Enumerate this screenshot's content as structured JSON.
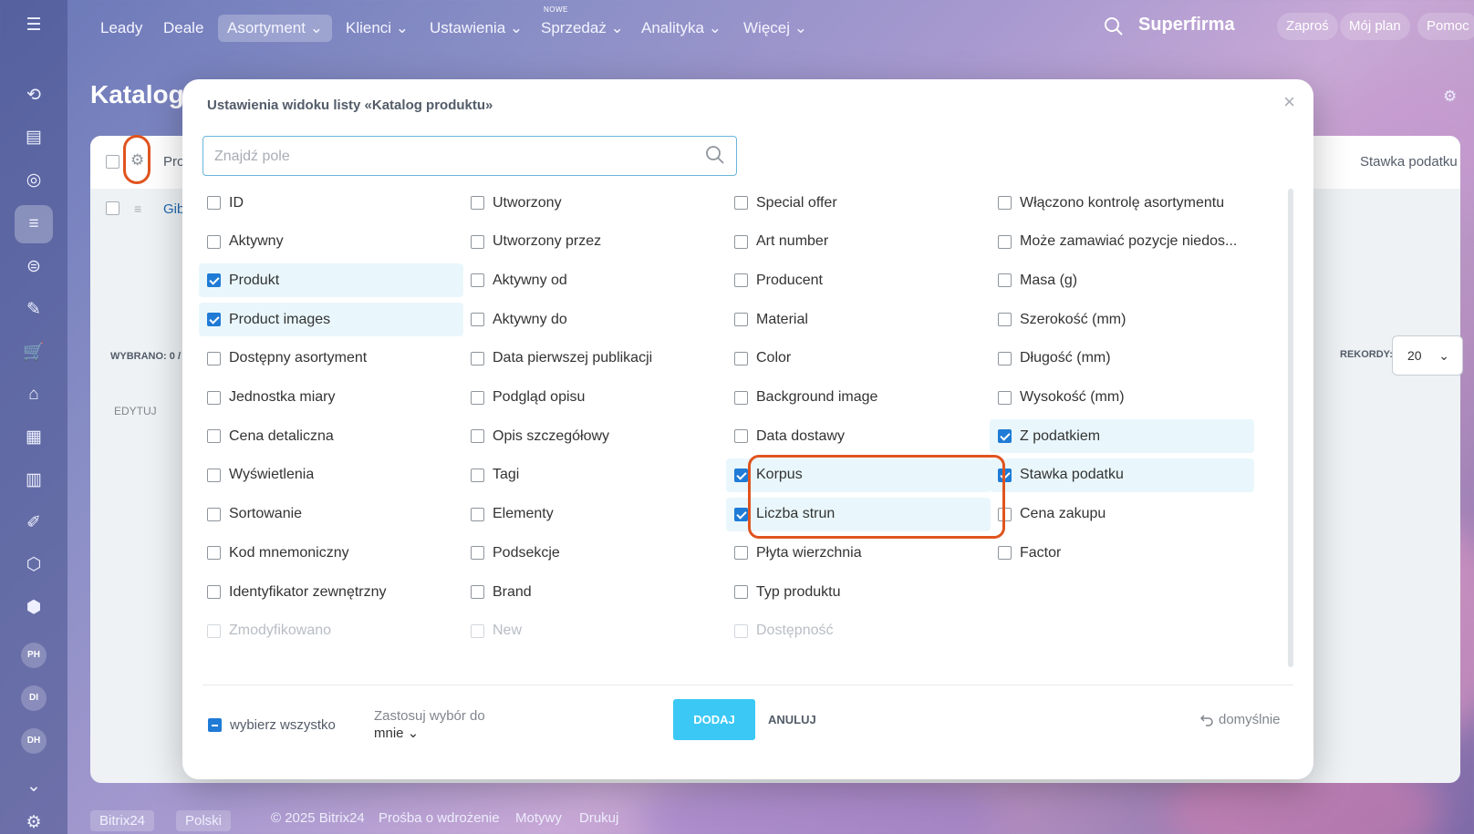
{
  "topnav": {
    "items": [
      {
        "label": "Leady"
      },
      {
        "label": "Deale"
      },
      {
        "label": "Asortyment ⌄"
      },
      {
        "label": "Klienci ⌄"
      },
      {
        "label": "Ustawienia ⌄"
      },
      {
        "label": "Sprzedaż ⌄",
        "badge": "NOWE"
      },
      {
        "label": "Analityka ⌄"
      },
      {
        "label": "Więcej ⌄"
      }
    ],
    "brand": "Superfirma",
    "invite": "Zaproś",
    "my_plan": "Mój plan",
    "help": "Pomoc"
  },
  "sidebar": {
    "avatars": [
      "PH",
      "DI",
      "DH"
    ]
  },
  "background_page": {
    "title": "Katalog",
    "header_product": "Pro",
    "header_tax": "Stawka podatku",
    "row_name": "Gib",
    "selected": "WYBRANO: 0 /",
    "records_label": "REKORDY:",
    "records_value": "20",
    "edit": "EDYTUJ"
  },
  "footer": {
    "brand": "Bitrix24",
    "language": "Polski",
    "copyright": "© 2025 Bitrix24",
    "request": "Prośba o wdrożenie",
    "themes": "Motywy",
    "print": "Drukuj"
  },
  "modal": {
    "title": "Ustawienia widoku listy «Katalog produktu»",
    "search_placeholder": "Znajdź pole",
    "columns": [
      [
        {
          "label": "ID",
          "checked": false
        },
        {
          "label": "Aktywny",
          "checked": false
        },
        {
          "label": "Produkt",
          "checked": true
        },
        {
          "label": "Product images",
          "checked": true
        },
        {
          "label": "Dostępny asortyment",
          "checked": false
        },
        {
          "label": "Jednostka miary",
          "checked": false
        },
        {
          "label": "Cena detaliczna",
          "checked": false
        },
        {
          "label": "Wyświetlenia",
          "checked": false
        },
        {
          "label": "Sortowanie",
          "checked": false
        },
        {
          "label": "Kod mnemoniczny",
          "checked": false
        },
        {
          "label": "Identyfikator zewnętrzny",
          "checked": false
        },
        {
          "label": "Zmodyfikowano",
          "checked": false,
          "disabled": true
        }
      ],
      [
        {
          "label": "Utworzony",
          "checked": false
        },
        {
          "label": "Utworzony przez",
          "checked": false
        },
        {
          "label": "Aktywny od",
          "checked": false
        },
        {
          "label": "Aktywny do",
          "checked": false
        },
        {
          "label": "Data pierwszej publikacji",
          "checked": false
        },
        {
          "label": "Podgląd opisu",
          "checked": false
        },
        {
          "label": "Opis szczegółowy",
          "checked": false
        },
        {
          "label": "Tagi",
          "checked": false
        },
        {
          "label": "Elementy",
          "checked": false
        },
        {
          "label": "Podsekcje",
          "checked": false
        },
        {
          "label": "Brand",
          "checked": false
        },
        {
          "label": "New",
          "checked": false,
          "disabled": true
        }
      ],
      [
        {
          "label": "Special offer",
          "checked": false
        },
        {
          "label": "Art number",
          "checked": false
        },
        {
          "label": "Producent",
          "checked": false
        },
        {
          "label": "Material",
          "checked": false
        },
        {
          "label": "Color",
          "checked": false
        },
        {
          "label": "Background image",
          "checked": false
        },
        {
          "label": "Data dostawy",
          "checked": false
        },
        {
          "label": "Korpus",
          "checked": true
        },
        {
          "label": "Liczba strun",
          "checked": true
        },
        {
          "label": "Płyta wierzchnia",
          "checked": false
        },
        {
          "label": "Typ produktu",
          "checked": false
        },
        {
          "label": "Dostępność",
          "checked": false,
          "disabled": true
        }
      ],
      [
        {
          "label": "Włączono kontrolę asortymentu",
          "checked": false
        },
        {
          "label": "Może zamawiać pozycje niedos...",
          "checked": false
        },
        {
          "label": "Masa (g)",
          "checked": false
        },
        {
          "label": "Szerokość (mm)",
          "checked": false
        },
        {
          "label": "Długość (mm)",
          "checked": false
        },
        {
          "label": "Wysokość (mm)",
          "checked": false
        },
        {
          "label": "Z podatkiem",
          "checked": true
        },
        {
          "label": "Stawka podatku",
          "checked": true
        },
        {
          "label": "Cena zakupu",
          "checked": false
        },
        {
          "label": "Factor",
          "checked": false
        }
      ]
    ],
    "select_all_label": "wybierz wszystko",
    "apply_label": "Zastosuj wybór do",
    "apply_value": "mnie ⌄",
    "add_button": "DODAJ",
    "cancel_button": "ANULUJ",
    "default_button": "domyślnie"
  },
  "colors": {
    "accent": "#3bc8f5",
    "checkbox": "#1f7bd6",
    "highlight": "#e0541f",
    "checked_row_bg": "#e9f7fc"
  }
}
